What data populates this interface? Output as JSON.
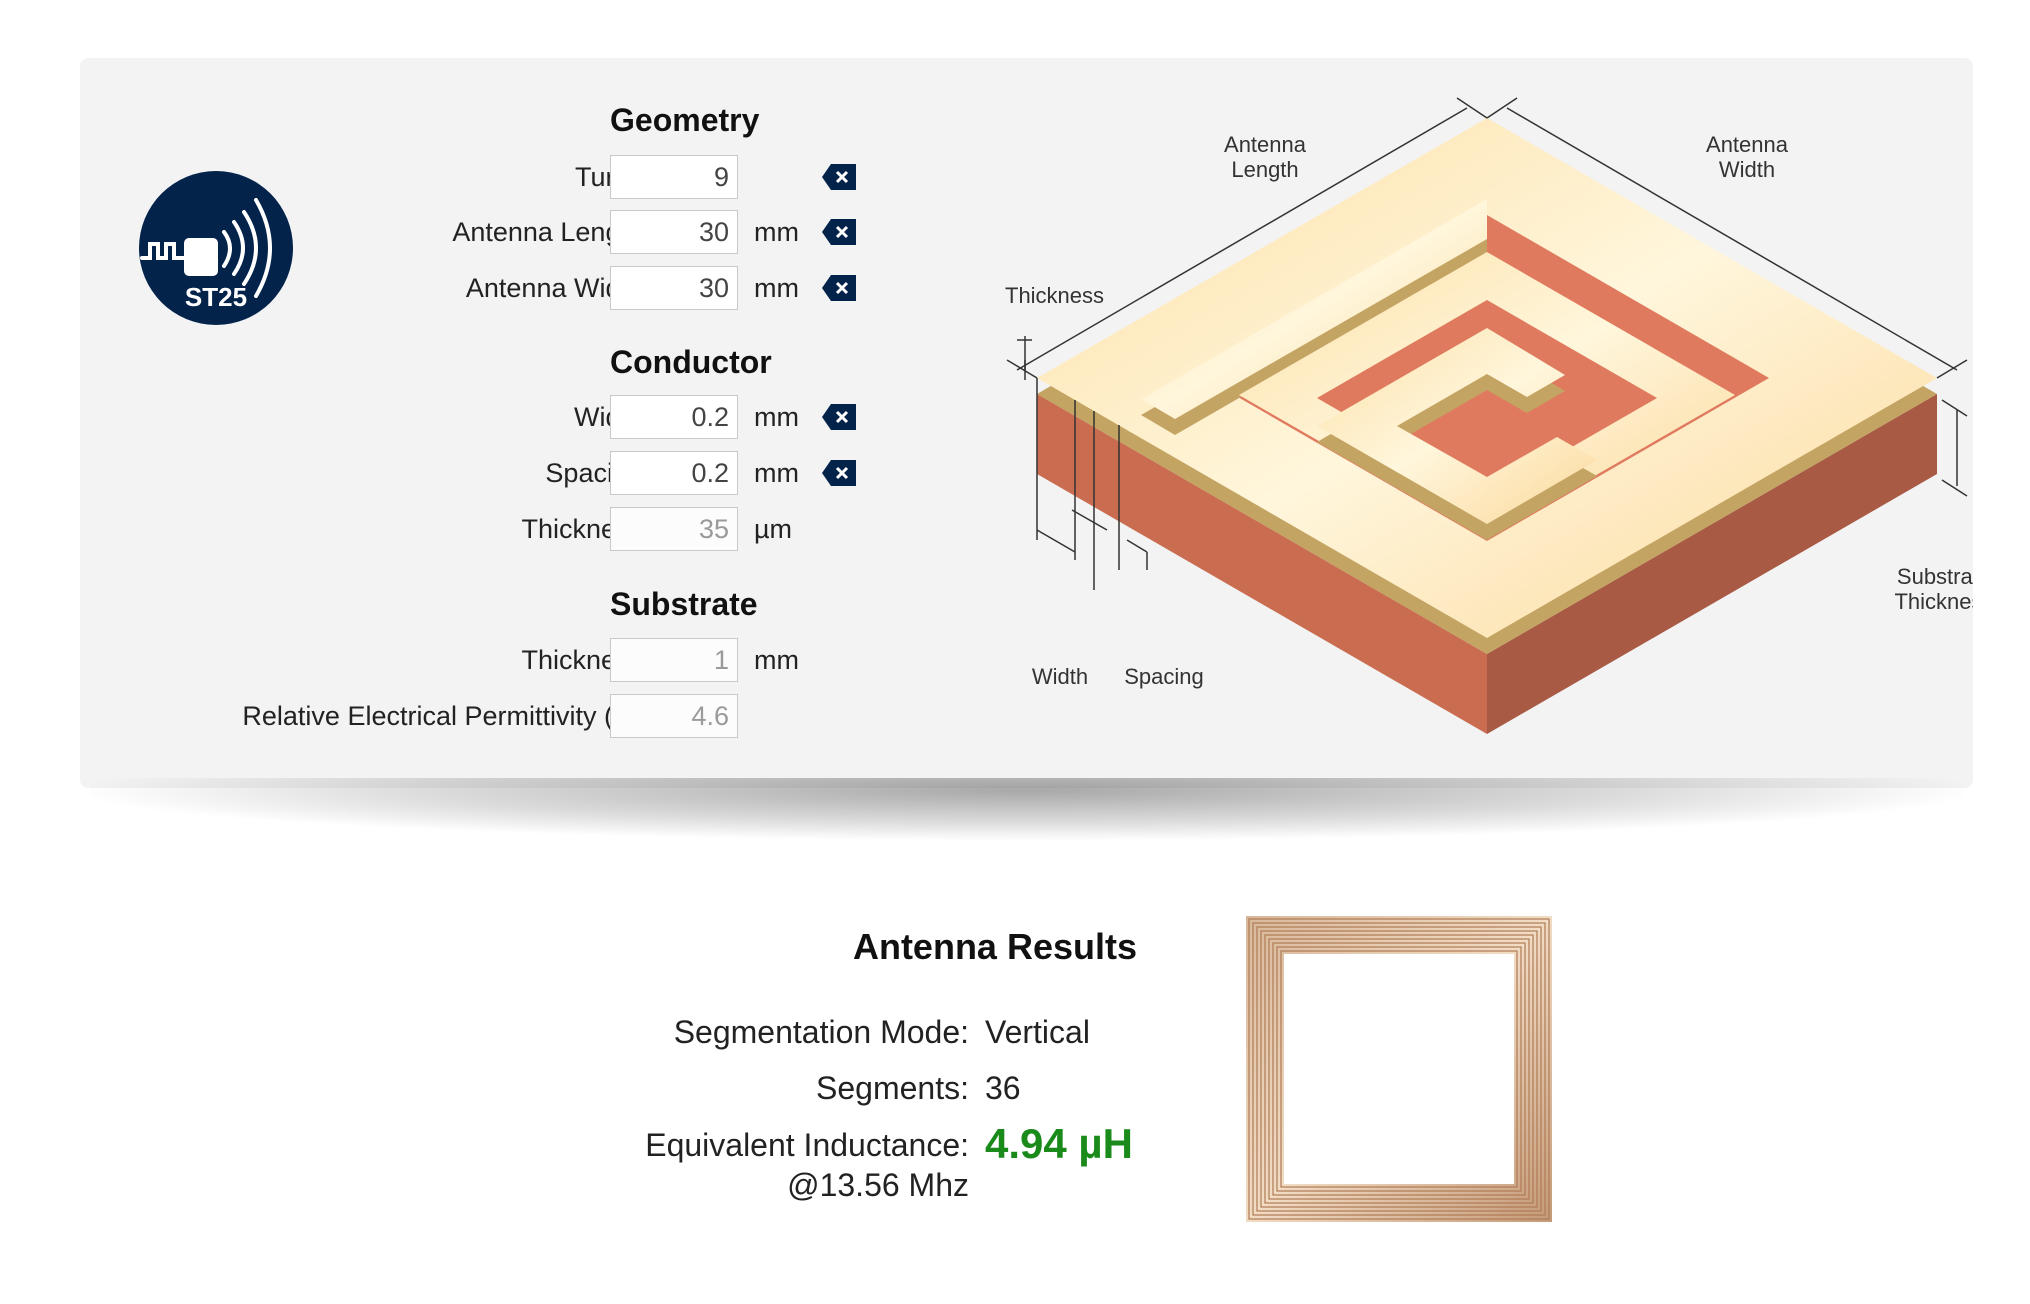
{
  "logo": {
    "text": "ST25",
    "icon": "nfc-antenna-logo-icon"
  },
  "geometry": {
    "title": "Geometry",
    "turns": {
      "label": "Turns",
      "value": "9",
      "unit": ""
    },
    "length": {
      "label": "Antenna Length",
      "value": "30",
      "unit": "mm"
    },
    "width": {
      "label": "Antenna Width",
      "value": "30",
      "unit": "mm"
    }
  },
  "conductor": {
    "title": "Conductor",
    "width": {
      "label": "Width",
      "value": "0.2",
      "unit": "mm"
    },
    "spacing": {
      "label": "Spacing",
      "value": "0.2",
      "unit": "mm"
    },
    "thickness": {
      "label": "Thickness",
      "value": "35",
      "unit": "µm"
    }
  },
  "substrate": {
    "title": "Substrate",
    "thickness": {
      "label": "Thickness",
      "value": "1",
      "unit": "mm"
    },
    "permittivity": {
      "label": "Relative Electrical Permittivity (εr)",
      "value": "4.6"
    }
  },
  "diagram": {
    "antenna_length": [
      "Antenna",
      "Length"
    ],
    "antenna_width": [
      "Antenna",
      "Width"
    ],
    "thickness": "Thickness",
    "substrate_thickness": [
      "Substrate",
      "Thickness"
    ],
    "width": "Width",
    "spacing": "Spacing"
  },
  "results": {
    "title": "Antenna Results",
    "segmentation_label": "Segmentation Mode:",
    "segmentation_value": "Vertical",
    "segments_label": "Segments:",
    "segments_value": "36",
    "inductance_label": "Equivalent Inductance:",
    "inductance_value": "4.94 µH",
    "frequency": "@13.56 Mhz"
  },
  "colors": {
    "brand_navy": "#03234b",
    "copper_top": "#fde6b4",
    "copper_side": "#c3a463",
    "substrate_top": "#e07a5f",
    "substrate_front": "#c96c50",
    "substrate_right": "#a85a44",
    "result_green": "#1a8a1a"
  }
}
